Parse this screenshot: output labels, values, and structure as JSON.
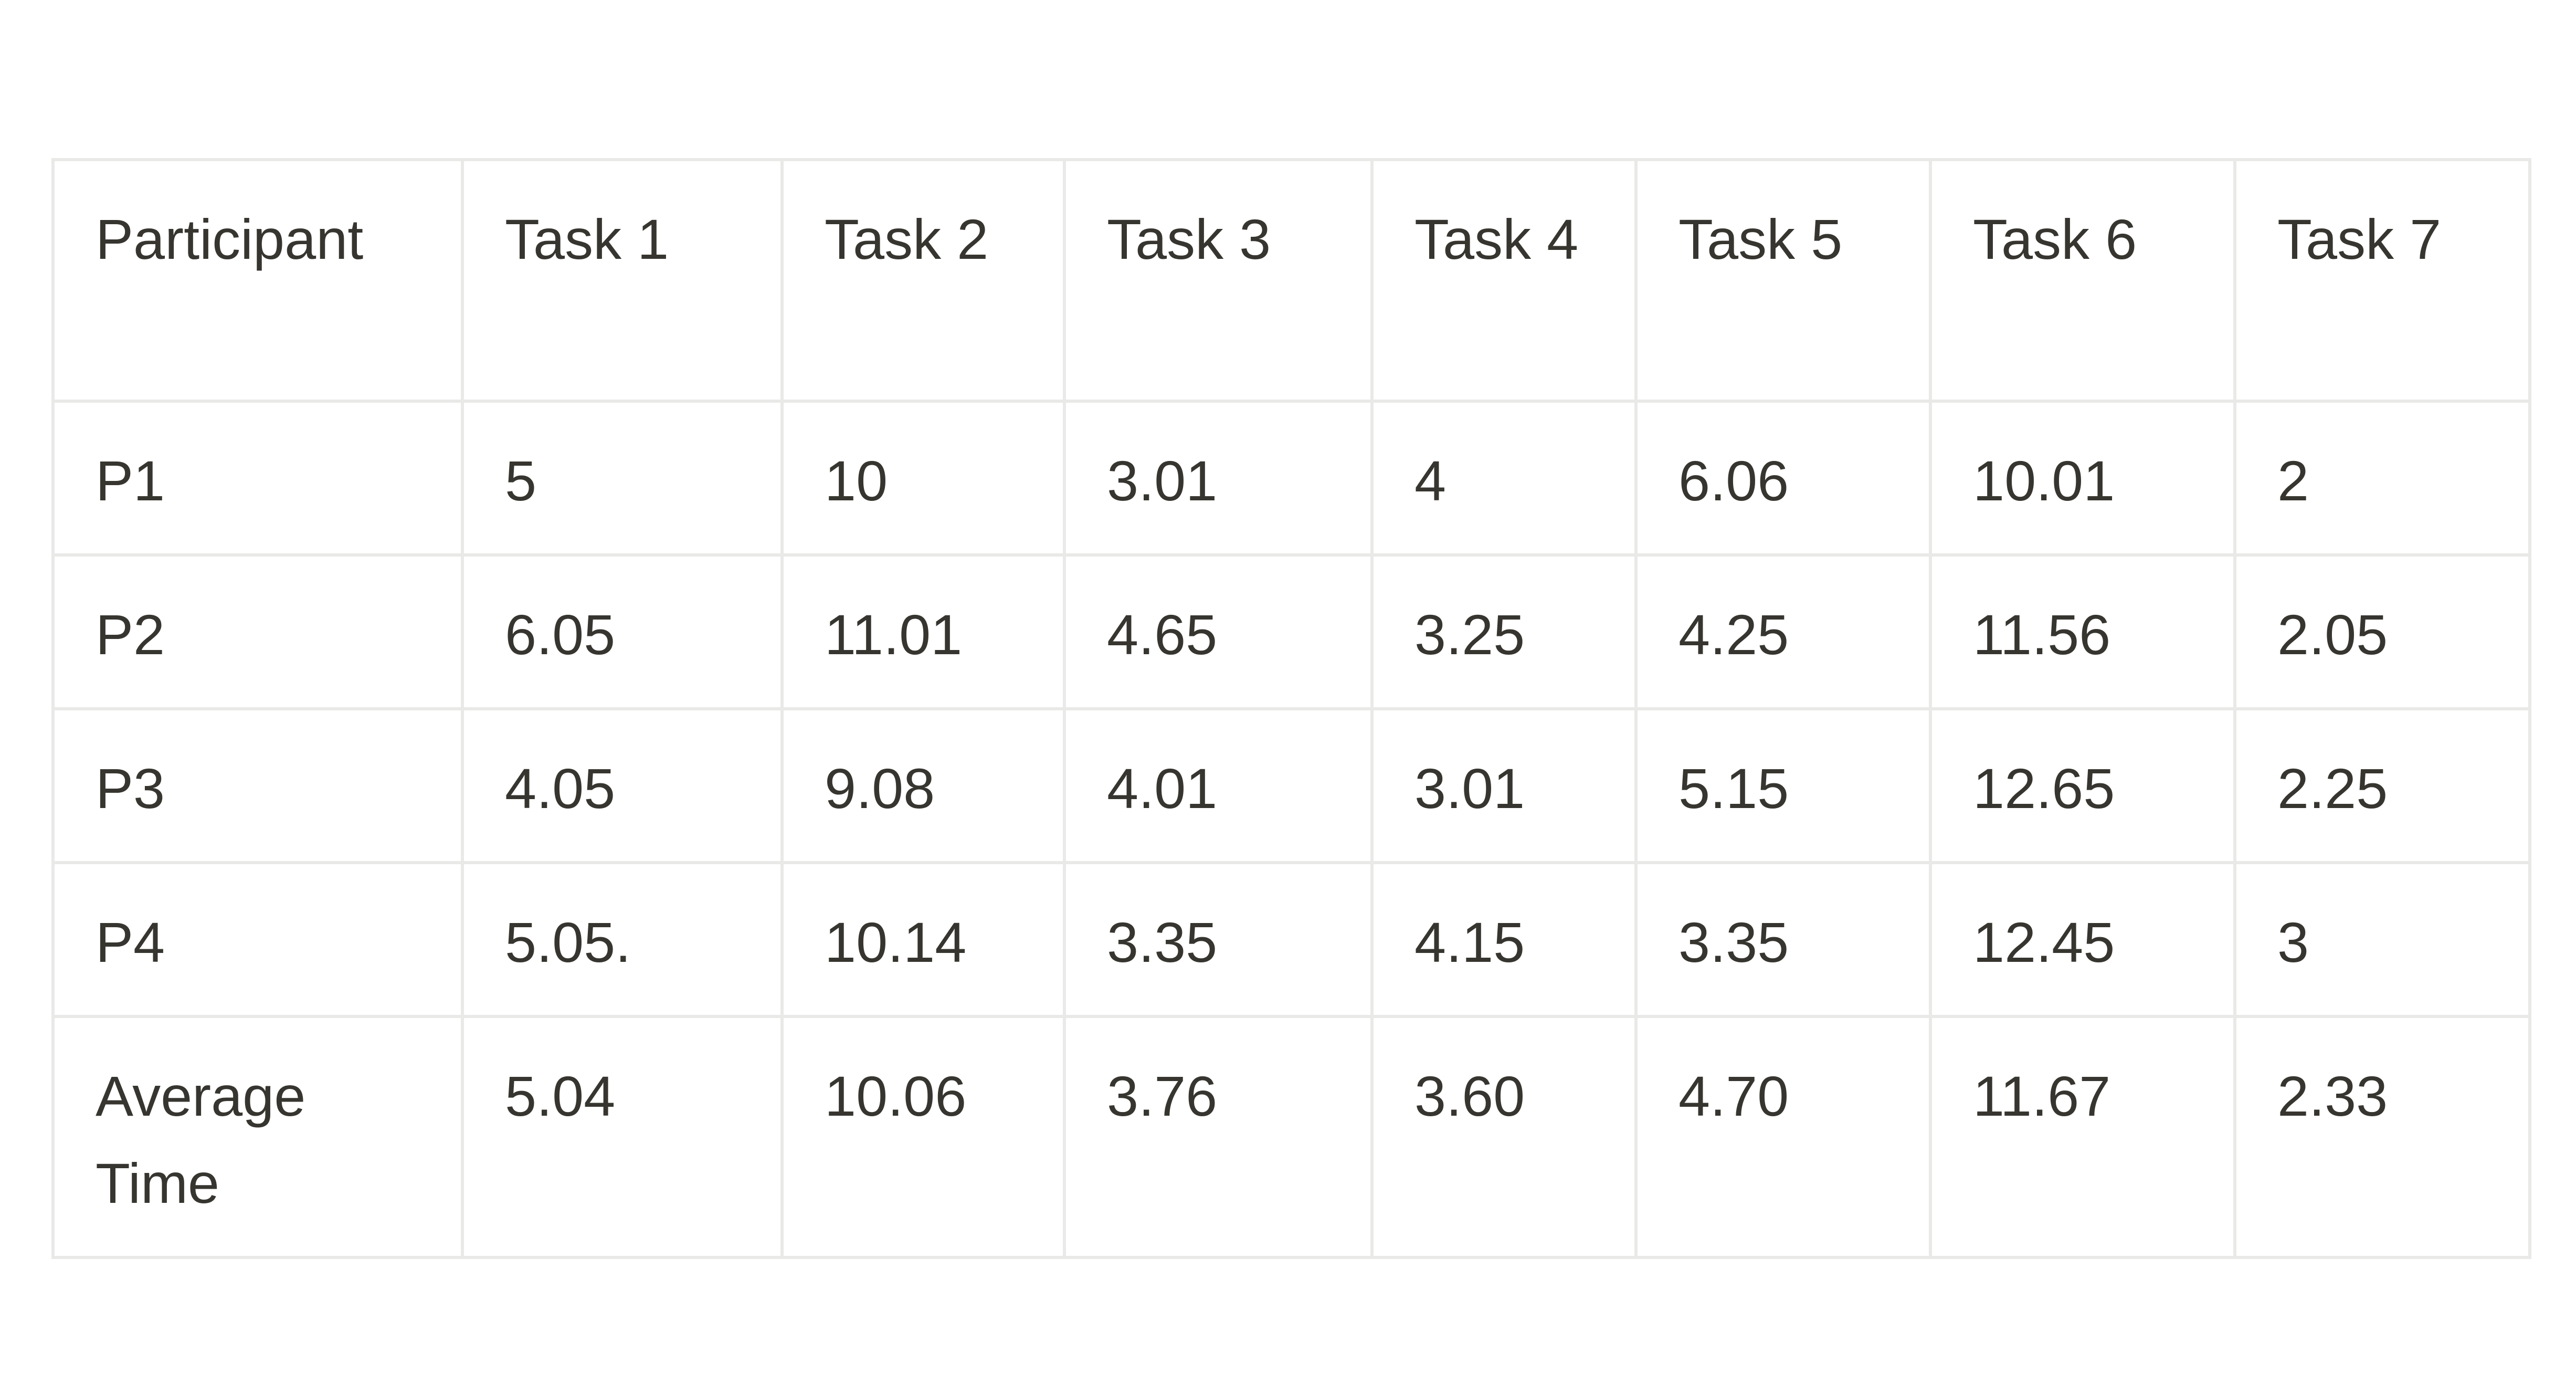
{
  "table": {
    "headers": [
      "Participant",
      "Task 1",
      "Task 2",
      "Task 3",
      "Task 4",
      "Task 5",
      "Task 6",
      "Task 7"
    ],
    "rows": [
      [
        "P1",
        "5",
        "10",
        "3.01",
        "4",
        "6.06",
        "10.01",
        "2"
      ],
      [
        "P2",
        "6.05",
        "11.01",
        "4.65",
        "3.25",
        "4.25",
        "11.56",
        "2.05"
      ],
      [
        "P3",
        "4.05",
        "9.08",
        "4.01",
        "3.01",
        "5.15",
        "12.65",
        "2.25"
      ],
      [
        "P4",
        "5.05.",
        "10.14",
        "3.35",
        "4.15",
        "3.35",
        "12.45",
        "3"
      ],
      [
        "Average Time",
        "5.04",
        "10.06",
        "3.76",
        "3.60",
        "4.70",
        "11.67",
        "2.33"
      ]
    ]
  },
  "colors": {
    "text": "#37352f",
    "border": "#e9e9e7",
    "background": "#ffffff"
  }
}
